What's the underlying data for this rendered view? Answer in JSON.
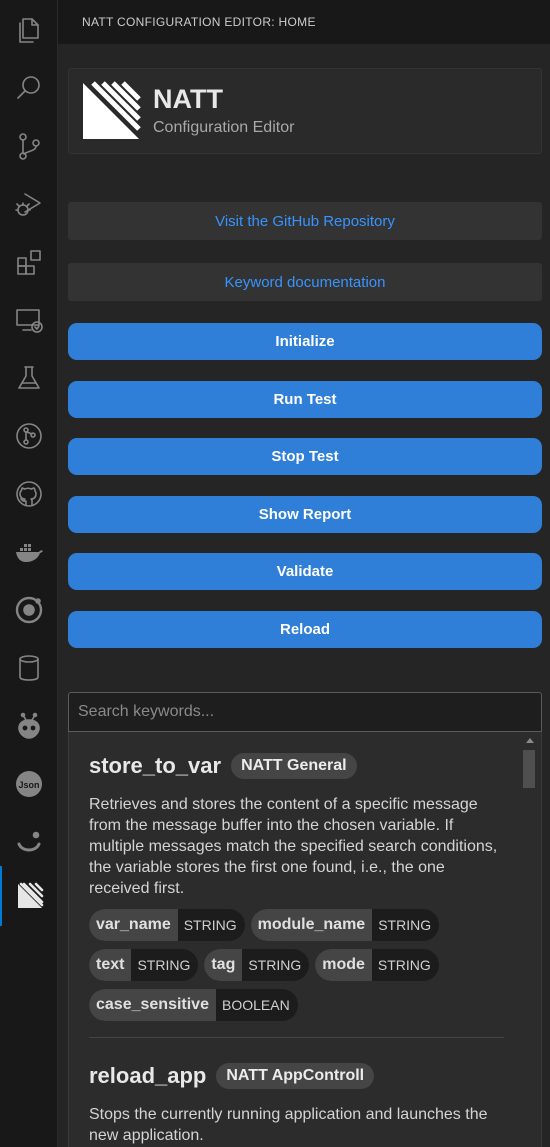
{
  "activity_bar": [
    {
      "icon": "files-icon"
    },
    {
      "icon": "search-icon"
    },
    {
      "icon": "source-control-icon"
    },
    {
      "icon": "run-debug-icon"
    },
    {
      "icon": "extensions-icon"
    },
    {
      "icon": "remote-explorer-icon"
    },
    {
      "icon": "testing-icon"
    },
    {
      "icon": "git-graph-icon"
    },
    {
      "icon": "github-icon"
    },
    {
      "icon": "docker-icon"
    },
    {
      "icon": "ionic-icon"
    },
    {
      "icon": "database-icon"
    },
    {
      "icon": "platformio-icon"
    },
    {
      "icon": "json-icon"
    },
    {
      "icon": "smiley-icon"
    },
    {
      "icon": "natt-icon",
      "active": true
    }
  ],
  "sidebar": {
    "header": "NATT CONFIGURATION EDITOR: HOME",
    "logo": {
      "title": "NATT",
      "subtitle": "Configuration Editor"
    },
    "links": {
      "github": "Visit the GitHub Repository",
      "docs": "Keyword documentation"
    },
    "buttons": {
      "initialize": "Initialize",
      "run_test": "Run Test",
      "stop_test": "Stop Test",
      "show_report": "Show Report",
      "validate": "Validate",
      "reload": "Reload"
    },
    "search": {
      "placeholder": "Search keywords..."
    },
    "keywords": [
      {
        "name": "store_to_var",
        "category": "NATT General",
        "description": "Retrieves and stores the content of a specific message from the message buffer into the chosen variable. If multiple messages match the specified search conditions, the variable stores the first one found, i.e., the one received first.",
        "params": [
          {
            "name": "var_name",
            "type": "STRING"
          },
          {
            "name": "module_name",
            "type": "STRING"
          },
          {
            "name": "text",
            "type": "STRING"
          },
          {
            "name": "tag",
            "type": "STRING"
          },
          {
            "name": "mode",
            "type": "STRING"
          },
          {
            "name": "case_sensitive",
            "type": "BOOLEAN"
          }
        ]
      },
      {
        "name": "reload_app",
        "category": "NATT AppControll",
        "description": "Stops the currently running application and launches the new application."
      }
    ]
  },
  "colors": {
    "accent": "#2f7fd8",
    "link": "#3794ff",
    "active_indicator": "#0078d4"
  }
}
